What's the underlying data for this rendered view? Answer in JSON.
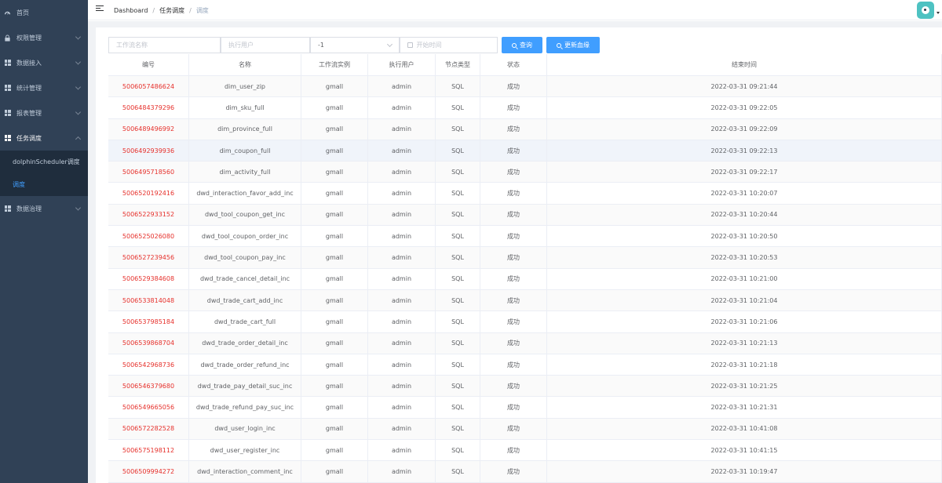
{
  "sidebar": {
    "items": [
      {
        "label": "首页",
        "icon": "dashboard-icon",
        "has_arrow": false
      },
      {
        "label": "权限管理",
        "icon": "lock-icon",
        "has_arrow": true
      },
      {
        "label": "数据接入",
        "icon": "grid-icon",
        "has_arrow": true
      },
      {
        "label": "统计管理",
        "icon": "grid-icon",
        "has_arrow": true
      },
      {
        "label": "报表管理",
        "icon": "grid-icon",
        "has_arrow": true
      },
      {
        "label": "任务调度",
        "icon": "grid-icon",
        "has_arrow": true,
        "open": true
      }
    ],
    "submenu": [
      {
        "label": "dolphinScheduler调度",
        "active": false
      },
      {
        "label": "调度",
        "active": true
      }
    ],
    "after": {
      "label": "数据治理",
      "icon": "grid-icon"
    }
  },
  "header": {
    "breadcrumb": [
      "Dashboard",
      "任务调度",
      "调度"
    ]
  },
  "filters": {
    "workflow_name_placeholder": "工作流名称",
    "exec_user_placeholder": "执行用户",
    "select_value": "-1",
    "start_time_placeholder": "开始时间",
    "query_label": "查询",
    "update_lineage_label": "更新血缘"
  },
  "table": {
    "headers": [
      "编号",
      "名称",
      "工作流实例",
      "执行用户",
      "节点类型",
      "状态",
      "结束时间"
    ],
    "rows": [
      [
        "5006057486624",
        "dim_user_zip",
        "gmall",
        "admin",
        "SQL",
        "成功",
        "2022-03-31 09:21:44"
      ],
      [
        "5006484379296",
        "dim_sku_full",
        "gmall",
        "admin",
        "SQL",
        "成功",
        "2022-03-31 09:22:05"
      ],
      [
        "5006489496992",
        "dim_province_full",
        "gmall",
        "admin",
        "SQL",
        "成功",
        "2022-03-31 09:22:09"
      ],
      [
        "5006492939936",
        "dim_coupon_full",
        "gmall",
        "admin",
        "SQL",
        "成功",
        "2022-03-31 09:22:13"
      ],
      [
        "5006495718560",
        "dim_activity_full",
        "gmall",
        "admin",
        "SQL",
        "成功",
        "2022-03-31 09:22:17"
      ],
      [
        "5006520192416",
        "dwd_interaction_favor_add_inc",
        "gmall",
        "admin",
        "SQL",
        "成功",
        "2022-03-31 10:20:07"
      ],
      [
        "5006522933152",
        "dwd_tool_coupon_get_inc",
        "gmall",
        "admin",
        "SQL",
        "成功",
        "2022-03-31 10:20:44"
      ],
      [
        "5006525026080",
        "dwd_tool_coupon_order_inc",
        "gmall",
        "admin",
        "SQL",
        "成功",
        "2022-03-31 10:20:50"
      ],
      [
        "5006527239456",
        "dwd_tool_coupon_pay_inc",
        "gmall",
        "admin",
        "SQL",
        "成功",
        "2022-03-31 10:20:53"
      ],
      [
        "5006529384608",
        "dwd_trade_cancel_detail_inc",
        "gmall",
        "admin",
        "SQL",
        "成功",
        "2022-03-31 10:21:00"
      ],
      [
        "5006533814048",
        "dwd_trade_cart_add_inc",
        "gmall",
        "admin",
        "SQL",
        "成功",
        "2022-03-31 10:21:04"
      ],
      [
        "5006537985184",
        "dwd_trade_cart_full",
        "gmall",
        "admin",
        "SQL",
        "成功",
        "2022-03-31 10:21:06"
      ],
      [
        "5006539868704",
        "dwd_trade_order_detail_inc",
        "gmall",
        "admin",
        "SQL",
        "成功",
        "2022-03-31 10:21:13"
      ],
      [
        "5006542968736",
        "dwd_trade_order_refund_inc",
        "gmall",
        "admin",
        "SQL",
        "成功",
        "2022-03-31 10:21:18"
      ],
      [
        "5006546379680",
        "dwd_trade_pay_detail_suc_inc",
        "gmall",
        "admin",
        "SQL",
        "成功",
        "2022-03-31 10:21:25"
      ],
      [
        "5006549665056",
        "dwd_trade_refund_pay_suc_inc",
        "gmall",
        "admin",
        "SQL",
        "成功",
        "2022-03-31 10:21:31"
      ],
      [
        "5006572282528",
        "dwd_user_login_inc",
        "gmall",
        "admin",
        "SQL",
        "成功",
        "2022-03-31 10:41:08"
      ],
      [
        "5006575198112",
        "dwd_user_register_inc",
        "gmall",
        "admin",
        "SQL",
        "成功",
        "2022-03-31 10:41:15"
      ],
      [
        "5006509994272",
        "dwd_interaction_comment_inc",
        "gmall",
        "admin",
        "SQL",
        "成功",
        "2022-03-31 10:19:47"
      ]
    ]
  },
  "colors": {
    "sidebar_bg": "#304156",
    "submenu_bg": "#1f2d3d",
    "accent": "#409eff",
    "id_link": "#e6302b"
  }
}
